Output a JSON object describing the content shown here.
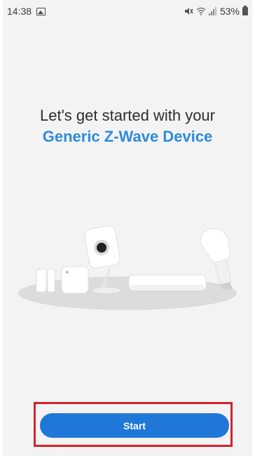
{
  "status_bar": {
    "time": "14:38",
    "battery": "53%",
    "icons": [
      "image-notification-icon",
      "mute-icon",
      "wifi-icon",
      "signal-icon",
      "battery-icon"
    ]
  },
  "onboarding": {
    "headline_prefix": "Let's get started with your",
    "device_name": "Generic Z-Wave Device",
    "illustration_items": [
      "door-sensor",
      "motion-sensor",
      "camera",
      "hub",
      "smart-bulb"
    ]
  },
  "actions": {
    "start_label": "Start"
  },
  "colors": {
    "accent": "#2f8bdc",
    "button": "#1f78d8",
    "highlight": "#d4232c",
    "background": "#f3f3f3"
  }
}
